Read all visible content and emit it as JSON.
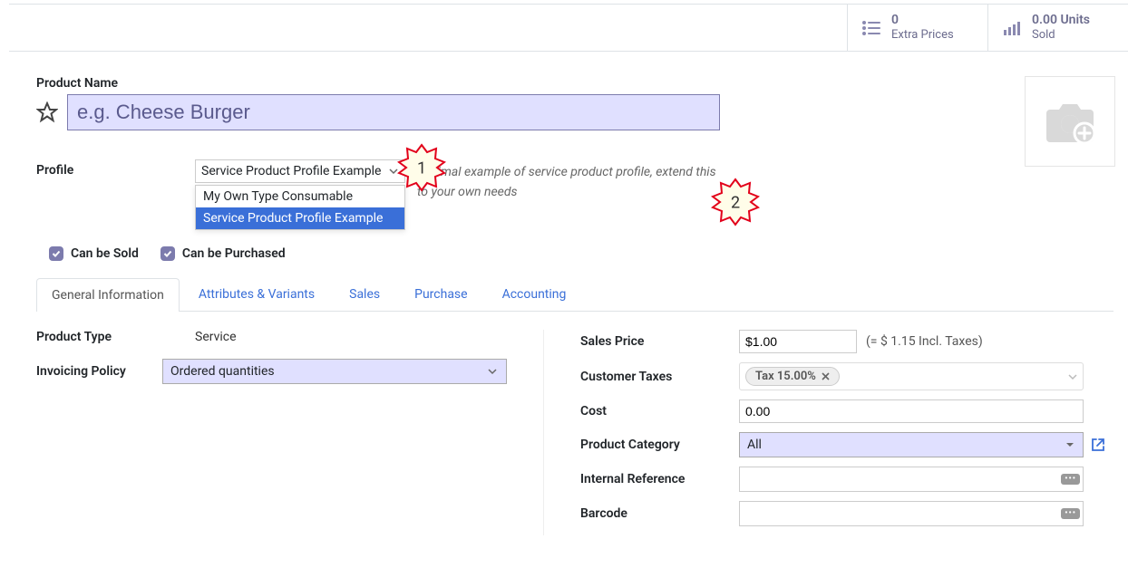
{
  "topbar": {
    "extra_prices": {
      "count": "0",
      "label": "Extra Prices"
    },
    "sold": {
      "count": "0.00 Units",
      "label": "Sold"
    }
  },
  "labels": {
    "product_name": "Product Name",
    "profile": "Profile",
    "can_be_sold": "Can be Sold",
    "can_be_purchased": "Can be Purchased",
    "product_type": "Product Type",
    "invoicing_policy": "Invoicing Policy",
    "sales_price": "Sales Price",
    "customer_taxes": "Customer Taxes",
    "cost": "Cost",
    "product_category": "Product Category",
    "internal_reference": "Internal Reference",
    "barcode": "Barcode"
  },
  "product_name": {
    "placeholder": "e.g. Cheese Burger",
    "value": ""
  },
  "profile": {
    "selected": "Service Product Profile Example",
    "options": [
      "My Own Type Consumable",
      "Service Product Profile Example"
    ],
    "description": "Minimal example of service product profile, extend this to your own needs"
  },
  "tabs": [
    "General Information",
    "Attributes & Variants",
    "Sales",
    "Purchase",
    "Accounting"
  ],
  "active_tab": 0,
  "general": {
    "product_type": "Service",
    "invoicing_policy": "Ordered quantities",
    "sales_price": "$1.00",
    "sales_price_incl": "(= $ 1.15 Incl. Taxes)",
    "customer_taxes": [
      "Tax 15.00%"
    ],
    "cost": "0.00",
    "product_category": "All",
    "internal_reference": "",
    "barcode": ""
  },
  "annotations": [
    "1",
    "2"
  ]
}
